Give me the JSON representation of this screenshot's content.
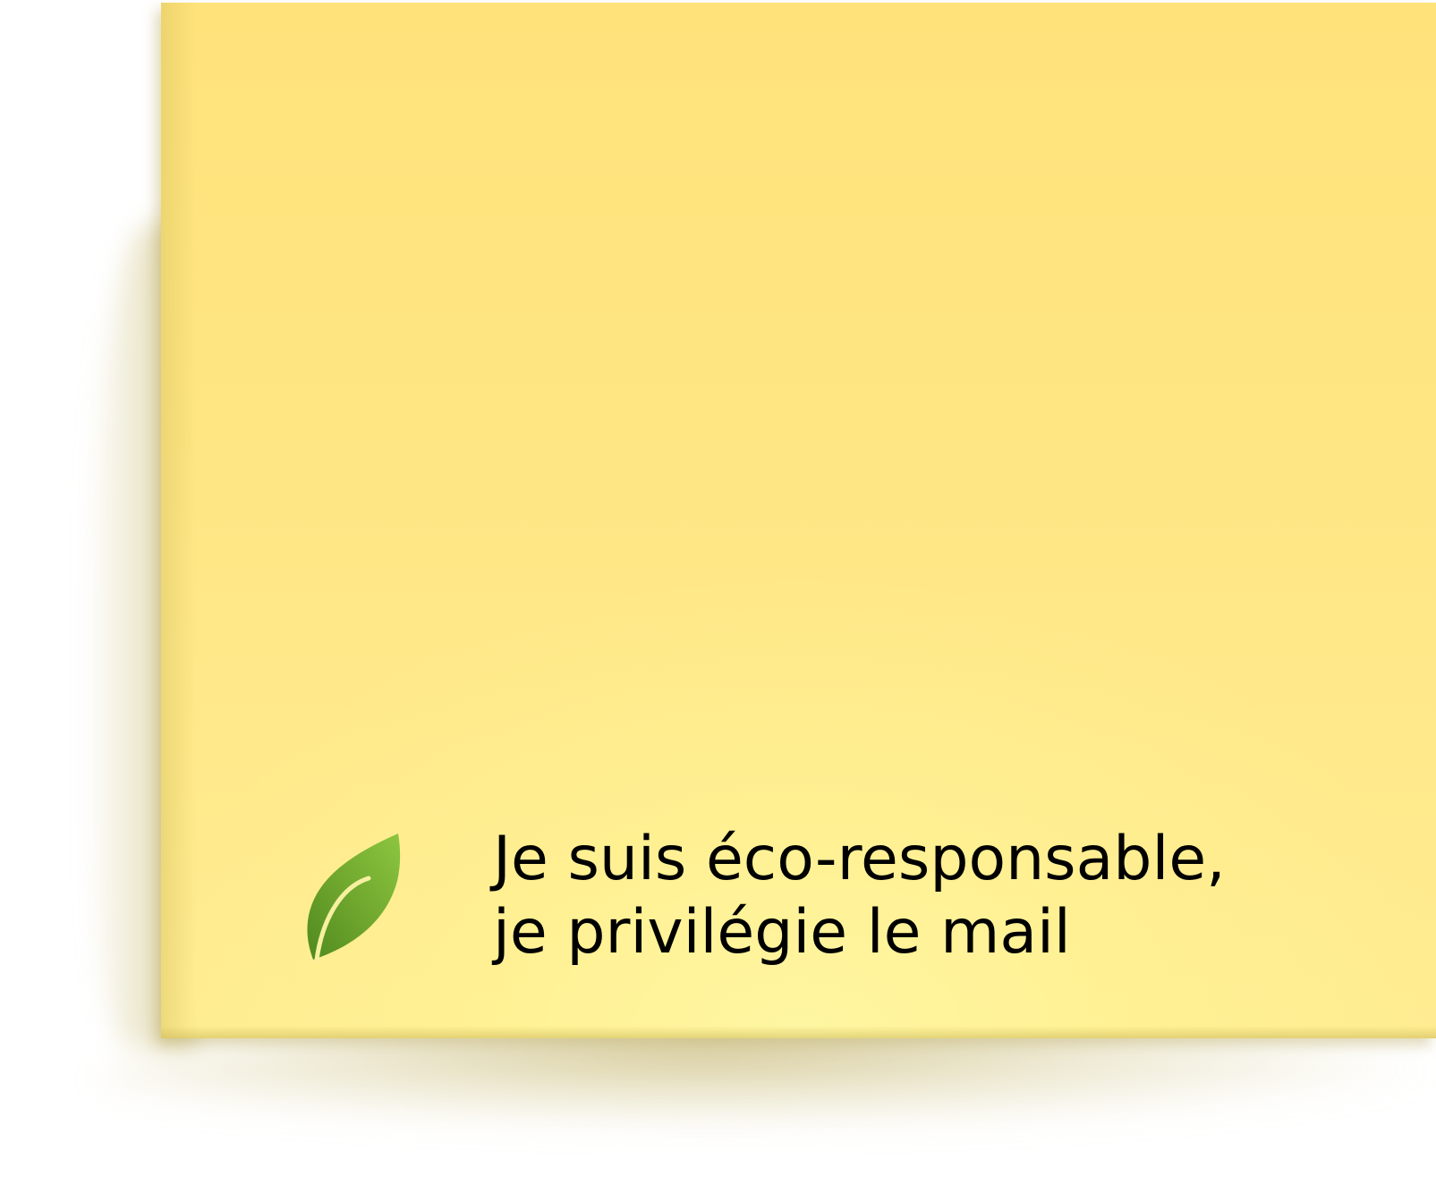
{
  "note": {
    "background_color": "#ffe684",
    "message_lines": [
      "Je suis éco-responsable,",
      "je privilégie le mail"
    ],
    "icon": "leaf-icon",
    "icon_colors": [
      "#8cc63f",
      "#4f8a1f"
    ],
    "text_color": "#000000"
  }
}
